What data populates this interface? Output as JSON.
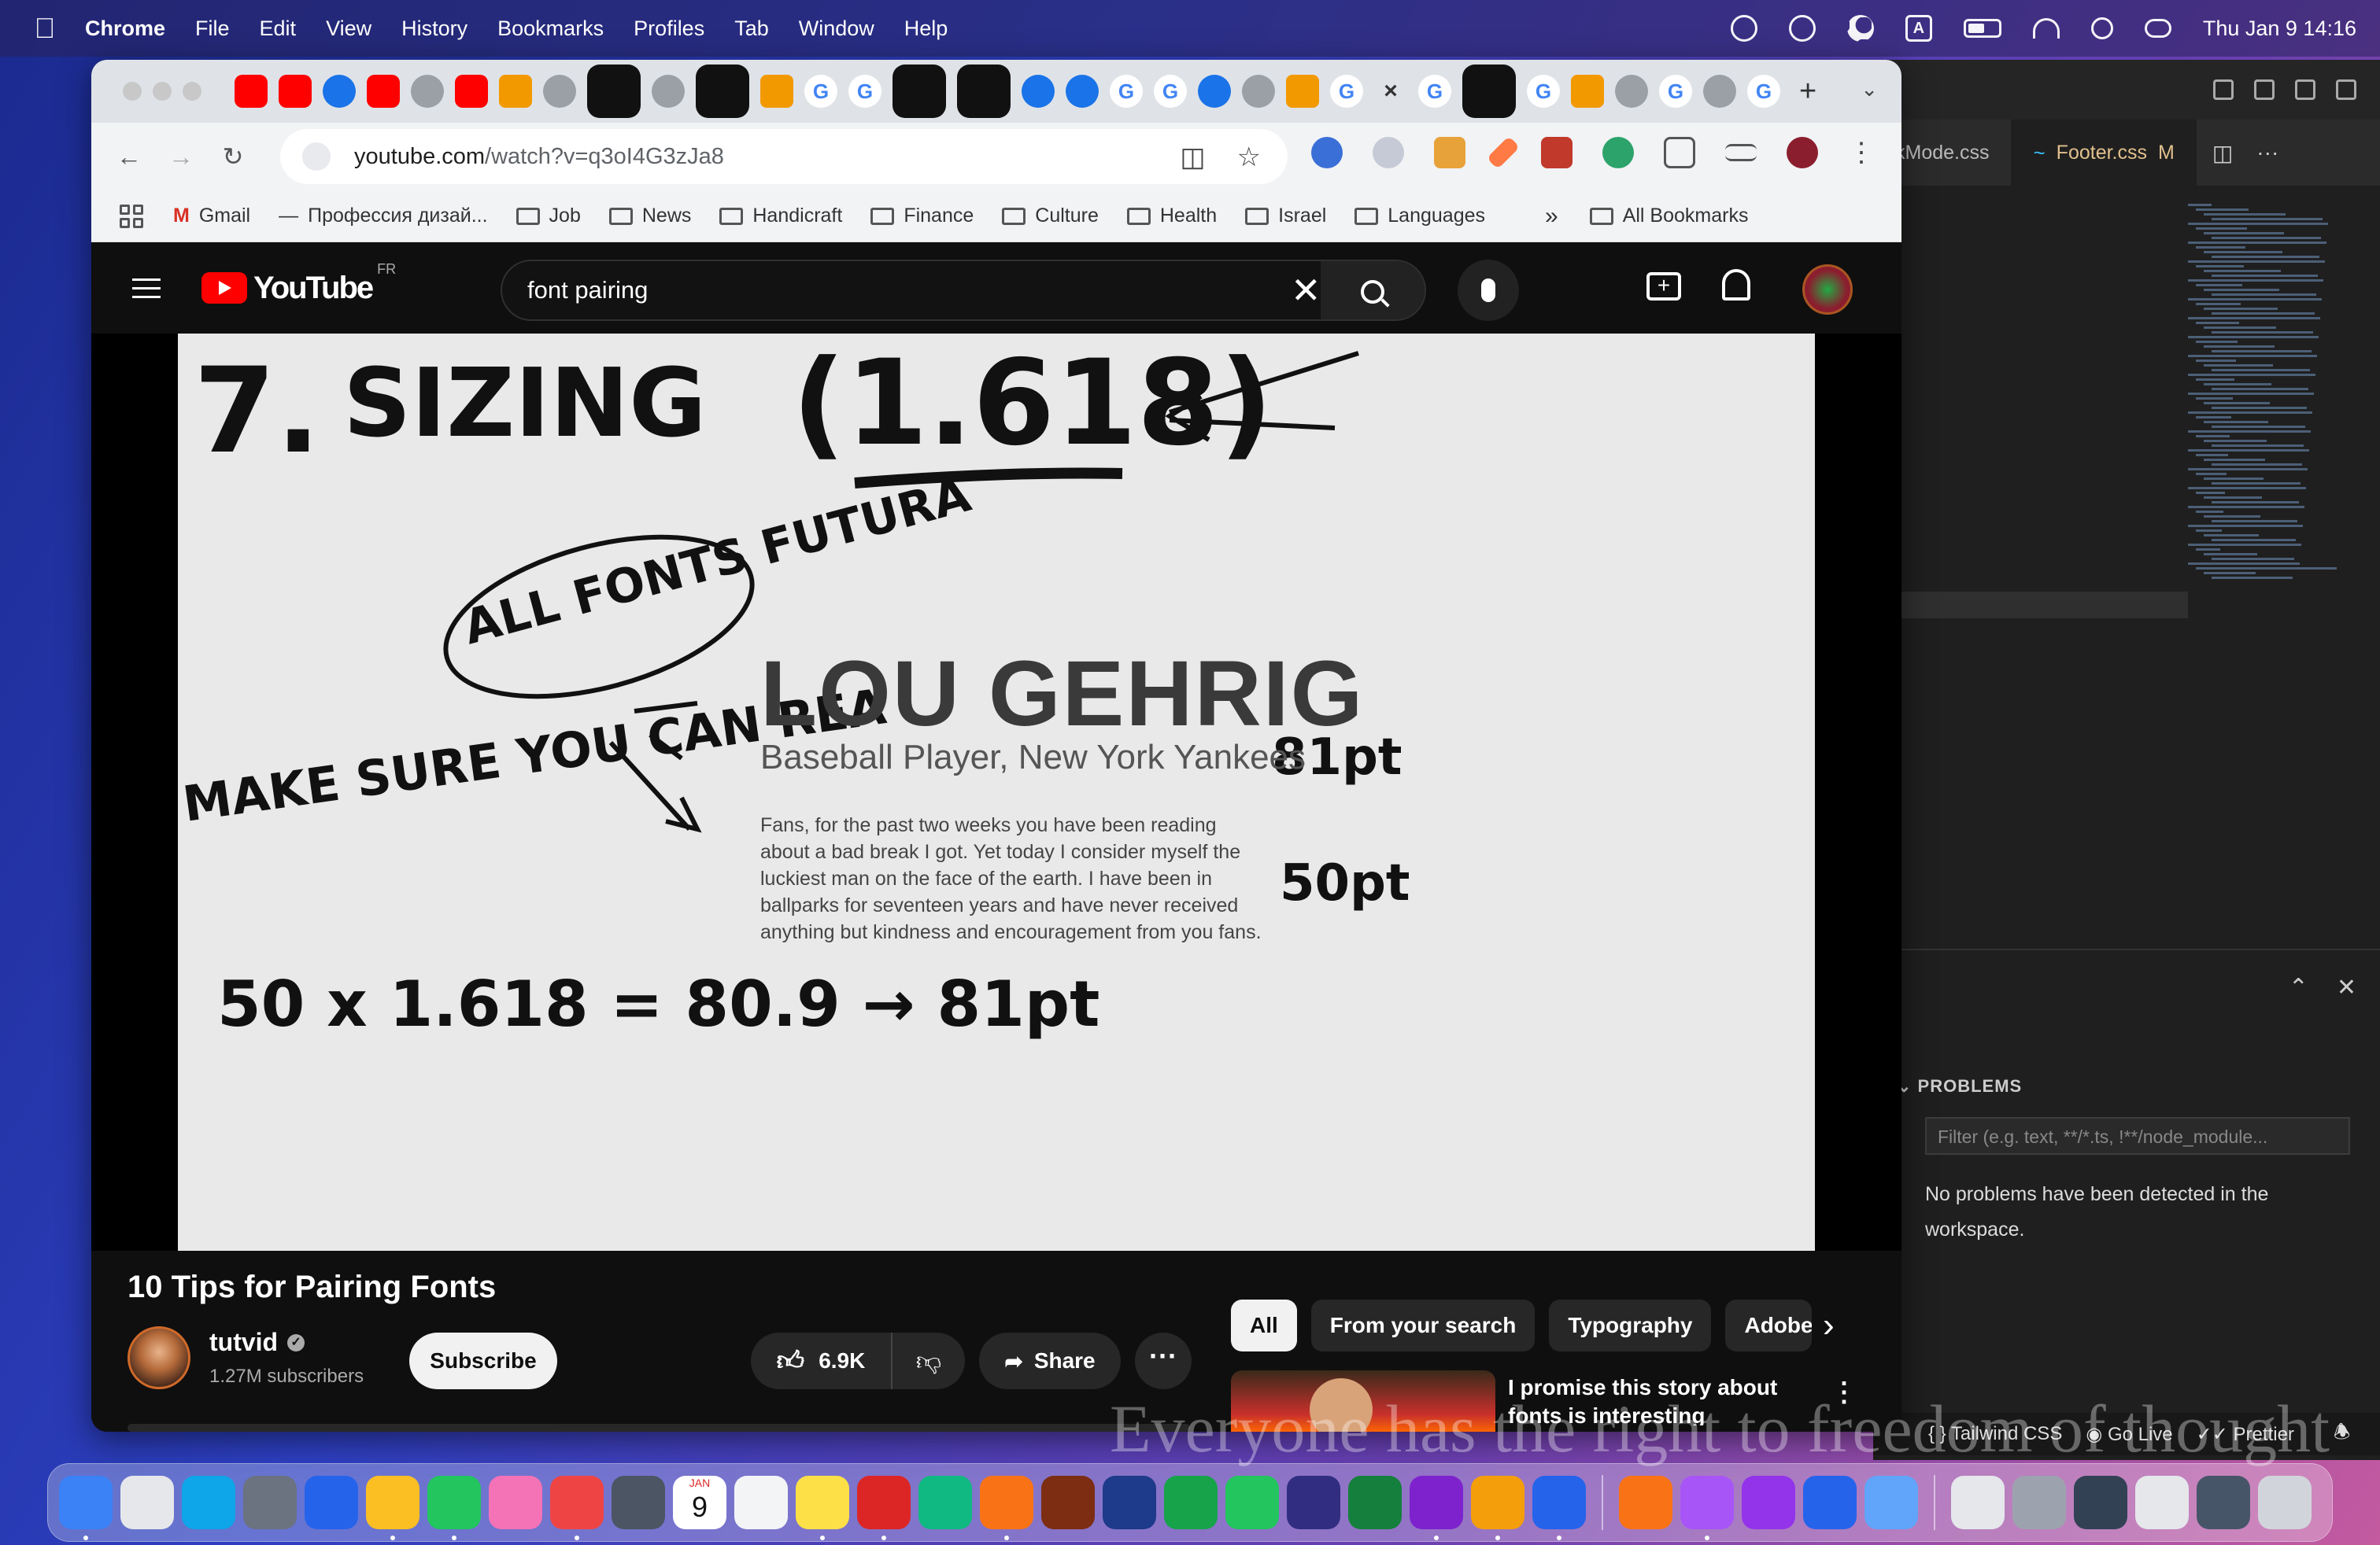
{
  "menubar": {
    "app": "Chrome",
    "items": [
      "File",
      "Edit",
      "View",
      "History",
      "Bookmarks",
      "Profiles",
      "Tab",
      "Window",
      "Help"
    ],
    "clock": "Thu Jan 9  14:16",
    "status_icons": [
      "vpn-icon",
      "play-circle-icon",
      "moon-icon",
      "input-source-icon",
      "battery-icon",
      "wifi-icon",
      "spotlight-icon",
      "control-center-icon"
    ],
    "input_source": "A"
  },
  "vscode": {
    "tab_partial": "kMode.css",
    "tab_active": "Footer.css",
    "tab_active_badge": "M",
    "problems_title": "PROBLEMS",
    "filter_placeholder": "Filter (e.g. text, **/*.ts, !**/node_module...",
    "no_problems": "No problems have been detected in the workspace.",
    "status": [
      "{ } Tailwind CSS",
      "Go Live",
      "Prettier"
    ]
  },
  "chrome": {
    "url_host": "youtube.com",
    "url_path": "/watch?v=q3oI4G3zJa8",
    "bookmarks": [
      {
        "label": "Gmail",
        "icon": "gmail-icon"
      },
      {
        "label": "Профессия дизай...",
        "icon": "dash-icon"
      },
      {
        "label": "Job",
        "icon": "folder-icon"
      },
      {
        "label": "News",
        "icon": "folder-icon"
      },
      {
        "label": "Handicraft",
        "icon": "folder-icon"
      },
      {
        "label": "Finance",
        "icon": "folder-icon"
      },
      {
        "label": "Culture",
        "icon": "folder-icon"
      },
      {
        "label": "Health",
        "icon": "folder-icon"
      },
      {
        "label": "Israel",
        "icon": "folder-icon"
      },
      {
        "label": "Languages",
        "icon": "folder-icon"
      }
    ],
    "bookmarks_more": "»",
    "all_bookmarks": "All Bookmarks",
    "tab_favicons": [
      "yt",
      "yt",
      "bl",
      "yt",
      "gr",
      "yt",
      "or",
      "gr",
      "dk",
      "gr",
      "dk",
      "or",
      "g",
      "g",
      "dk",
      "dk",
      "bl",
      "bl",
      "g",
      "g",
      "bl",
      "gr",
      "or",
      "g",
      "closer",
      "g",
      "dk",
      "g",
      "or",
      "gr",
      "g",
      "gr",
      "g"
    ],
    "closer_glyph": "×",
    "new_tab": "+"
  },
  "youtube": {
    "region": "FR",
    "search_value": "font pairing",
    "video_title": "10 Tips for Pairing Fonts",
    "channel": "tutvid",
    "subscribers": "1.27M subscribers",
    "subscribe": "Subscribe",
    "likes": "6.9K",
    "share": "Share",
    "chips": [
      "All",
      "From your search",
      "Typography",
      "Adobe"
    ],
    "rec_title": "I promise this story about fonts is interesting"
  },
  "frame": {
    "heading": "7. SIZING (1.618)",
    "bubble": "ALL FONTS FUTURA",
    "lou": "LOU GEHRIG",
    "lou_sub": "Baseball Player, New York Yankees",
    "lou_body": "Fans, for the past two weeks you have been reading about a bad break I got. Yet today I consider myself the luckiest man on the face of the earth. I have been in ballparks for seventeen years and have never received anything but kindness and encouragement from you fans.",
    "size_81": "81pt",
    "size_50": "50pt",
    "side_note": "MAKE SURE YOU CAN REA",
    "equation": "50 x 1.618 = 80.9 → 81pt"
  },
  "overlay_text": "Everyone has the right to freedom of thought",
  "dock": [
    "finder",
    "launchpad",
    "app-store",
    "system-settings",
    "safari",
    "chrome",
    "maps",
    "photos",
    "music",
    "calculator",
    "calendar",
    "reminders",
    "notes",
    "acrobat",
    "grammarly",
    "browser",
    "dictionary",
    "british-council",
    "bc-app",
    "bc-app2",
    "bc-app3",
    "bc-app4",
    "slack",
    "sketch",
    "vscode",
    "books",
    "djvu",
    "podcasts",
    "affinity",
    "quicktime",
    "doc",
    "image",
    "image2",
    "doc2",
    "doc3",
    "trash"
  ],
  "dock_calendar": {
    "month": "JAN",
    "day": "9"
  }
}
